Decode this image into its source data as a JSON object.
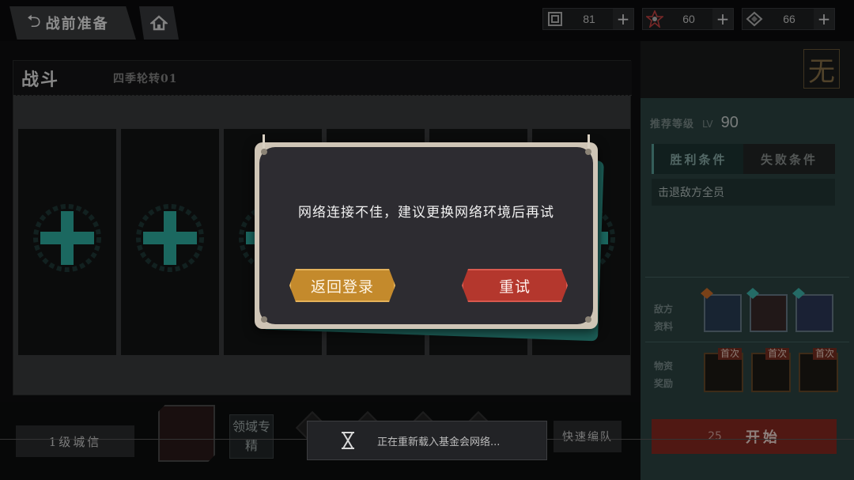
{
  "header": {
    "back_title": "战前准备",
    "resources": [
      {
        "icon": "stamina-icon",
        "value": "81"
      },
      {
        "icon": "badge-icon",
        "value": "60"
      },
      {
        "icon": "crystal-icon",
        "value": "66"
      }
    ],
    "add_symbol": "+"
  },
  "battle": {
    "title": "战斗",
    "stage": "四季轮转01",
    "empty_slots": 6
  },
  "side": {
    "element_badge": "无",
    "recommend_label": "推荐等级",
    "lv_prefix": "LV",
    "recommend_level": "90",
    "tab_win": "胜利条件",
    "tab_lose": "失败条件",
    "win_condition": "击退敌方全员",
    "enemy_label": "敌方资料",
    "reward_label": "物资奖励",
    "first_tag": "首次",
    "start_cost": "25",
    "start_label": "开始"
  },
  "bottom": {
    "preset_label": "1级城信",
    "domain_label": "领域专精",
    "quick_label": "快速编队"
  },
  "dialog": {
    "message": "网络连接不佳，建议更换网络环境后再试",
    "return_label": "返回登录",
    "retry_label": "重试"
  },
  "toast": {
    "message": "正在重新载入基金会网络..."
  },
  "colors": {
    "accent_teal": "#2fb3a6",
    "retry_red": "#b4372d",
    "return_gold": "#c48a2c"
  }
}
